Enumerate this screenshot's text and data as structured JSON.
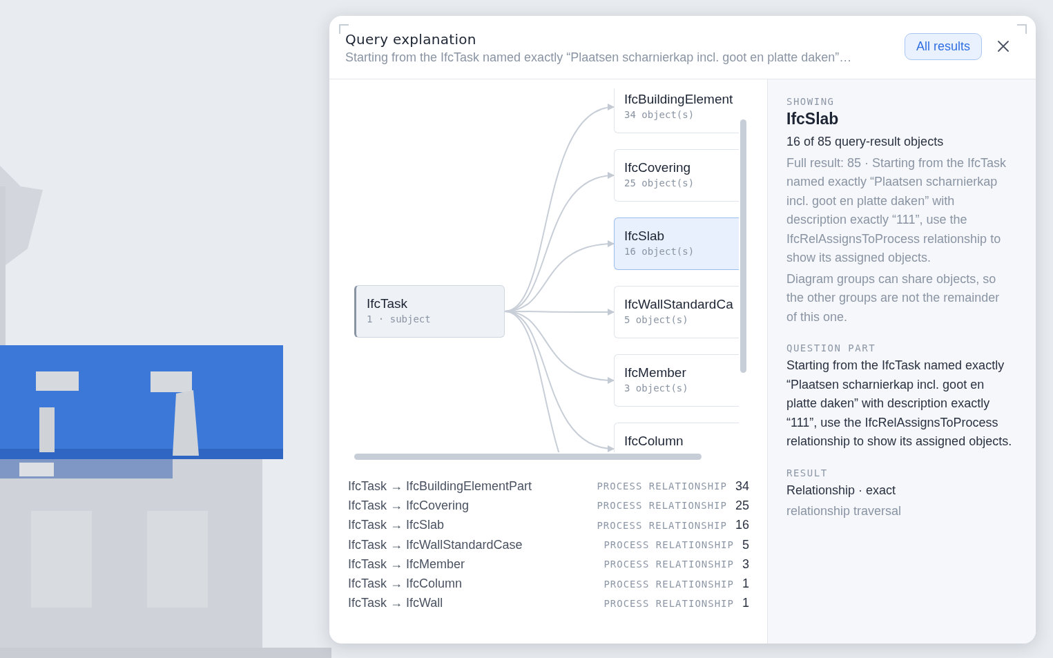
{
  "dialog": {
    "title": "Query explanation",
    "subtitle": "Starting from the IfcTask named exactly “Plaatsen scharnierkap incl. goot en platte daken”…",
    "primary_button": "All results"
  },
  "diagram": {
    "source": {
      "name": "IfcTask",
      "detail": "1 · subject"
    },
    "targets": [
      {
        "name": "IfcBuildingElement",
        "count": "34 object(s)",
        "selected": false
      },
      {
        "name": "IfcCovering",
        "count": "25 object(s)",
        "selected": false
      },
      {
        "name": "IfcSlab",
        "count": "16 object(s)",
        "selected": true
      },
      {
        "name": "IfcWallStandardCa",
        "count": "5 object(s)",
        "selected": false
      },
      {
        "name": "IfcMember",
        "count": "3 object(s)",
        "selected": false
      },
      {
        "name": "IfcColumn",
        "selected": false
      }
    ]
  },
  "relationships": [
    {
      "label": "IfcTask → IfcBuildingElementPart",
      "type": "PROCESS RELATIONSHIP",
      "count": "34"
    },
    {
      "label": "IfcTask → IfcCovering",
      "type": "PROCESS RELATIONSHIP",
      "count": "25"
    },
    {
      "label": "IfcTask → IfcSlab",
      "type": "PROCESS RELATIONSHIP",
      "count": "16"
    },
    {
      "label": "IfcTask → IfcWallStandardCase",
      "type": "PROCESS RELATIONSHIP",
      "count": "5"
    },
    {
      "label": "IfcTask → IfcMember",
      "type": "PROCESS RELATIONSHIP",
      "count": "3"
    },
    {
      "label": "IfcTask → IfcColumn",
      "type": "PROCESS RELATIONSHIP",
      "count": "1"
    },
    {
      "label": "IfcTask → IfcWall",
      "type": "PROCESS RELATIONSHIP",
      "count": "1"
    }
  ],
  "details": [
    {
      "heading": "SHOWING",
      "title": "IfcSlab",
      "lines": [
        {
          "text": "16 of 85 query-result objects",
          "muted": false
        },
        {
          "text": "Full result: 85 · Starting from the IfcTask named exactly “Plaatsen scharnierkap incl. goot en platte daken” with description exactly “111”, use the IfcRelAssignsToProcess relationship to show its assigned objects.",
          "muted": true
        },
        {
          "text": "Diagram groups can share objects, so the other groups are not the remainder of this one.",
          "muted": true
        }
      ]
    },
    {
      "heading": "QUESTION PART",
      "lines": [
        {
          "text": "Starting from the IfcTask named exactly “Plaatsen scharnierkap incl. goot en platte daken” with description exactly “111”, use the IfcRelAssignsToProcess relationship to show its assigned objects.",
          "muted": false
        }
      ]
    },
    {
      "heading": "RESULT",
      "lines": [
        {
          "text": "Relationship · exact",
          "muted": false
        },
        {
          "text": "relationship traversal",
          "muted": true
        }
      ]
    }
  ]
}
